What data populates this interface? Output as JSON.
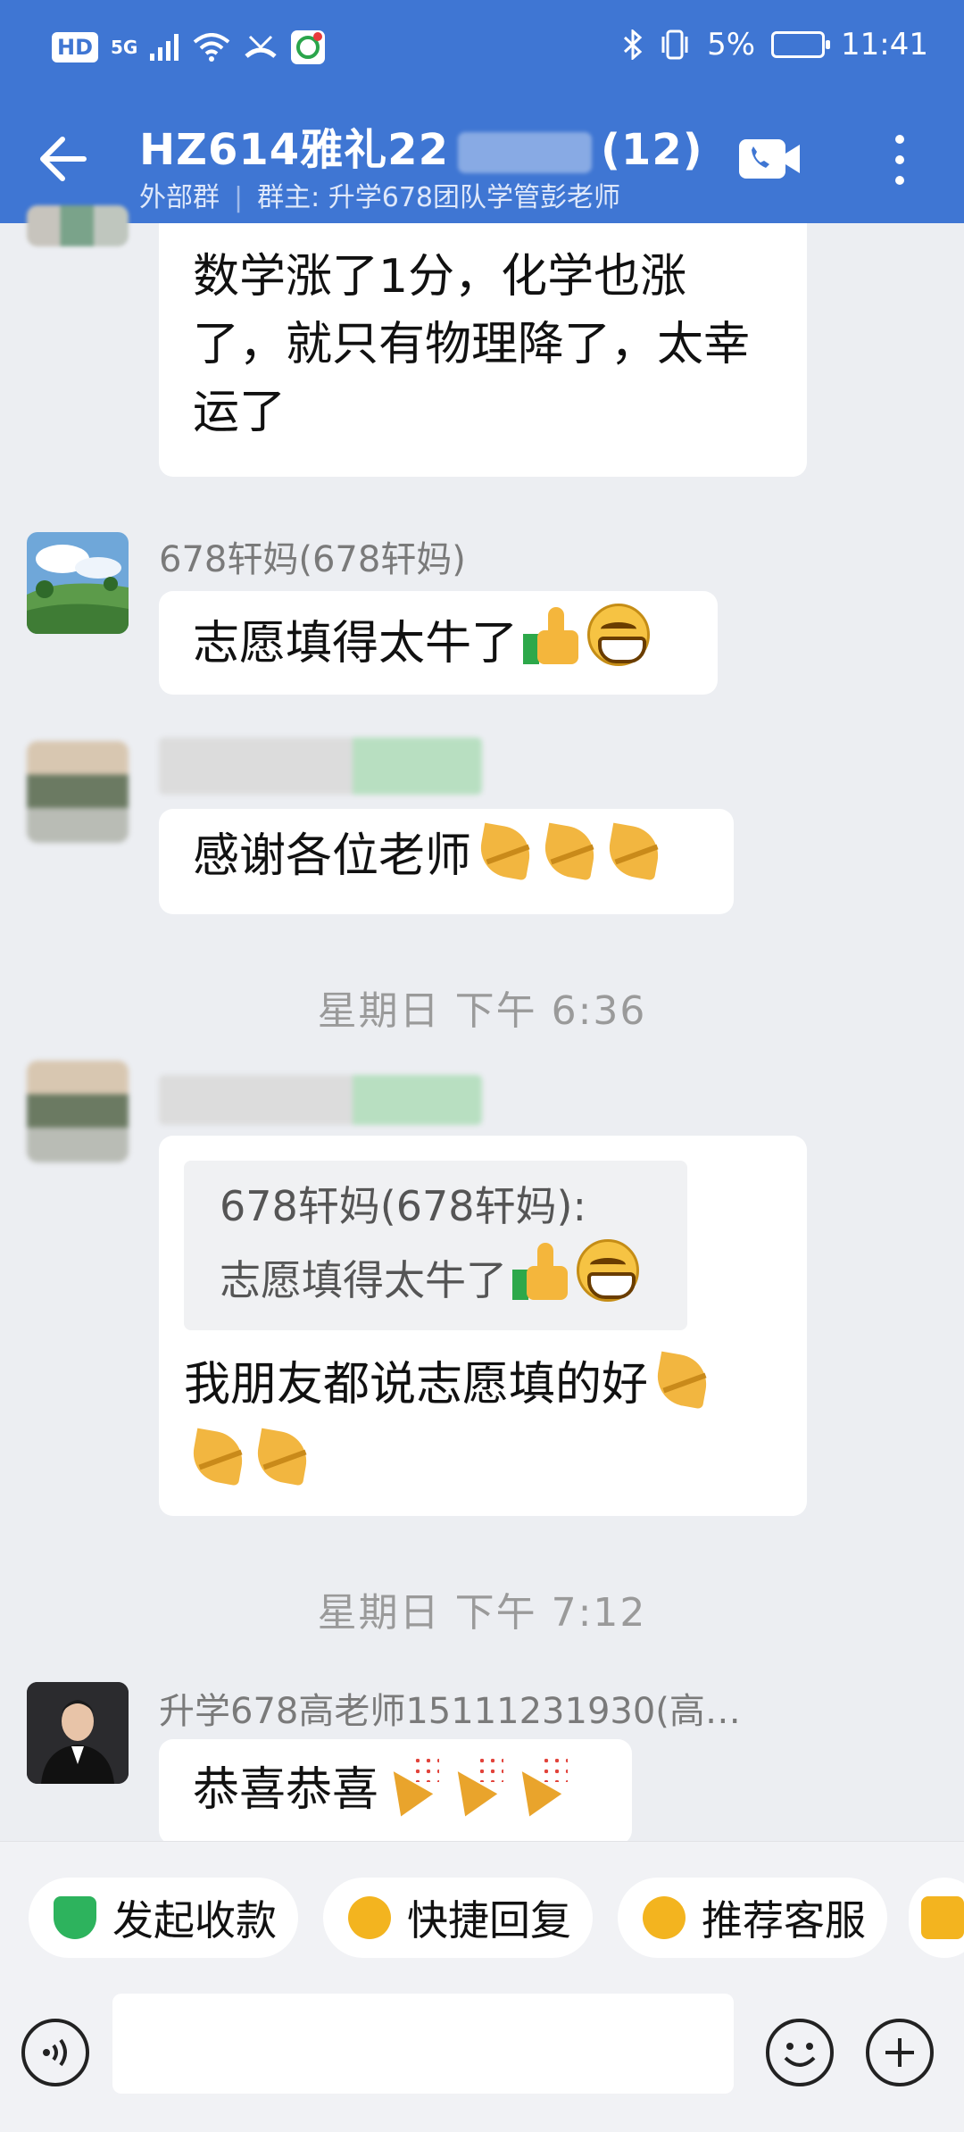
{
  "status_bar": {
    "left_badges": [
      "HD",
      "5G"
    ],
    "battery": "5%",
    "time": "11:41"
  },
  "header": {
    "title_prefix": "HZ614雅礼22",
    "title_count": "(12)",
    "subtitle_tag": "外部群",
    "subtitle_owner": "群主: 升学678团队学管彭老师",
    "bg_color": "#3f76d3"
  },
  "messages": [
    {
      "text": "数学涨了1分，化学也涨了，就只有物理降了，太幸运了"
    },
    {
      "sender": "678轩妈(678轩妈)",
      "text": "志愿填得太牛了"
    },
    {
      "text": "感谢各位老师"
    }
  ],
  "time_separators": [
    "星期日  下午 6:36",
    "星期日  下午 7:12"
  ],
  "quote": {
    "author": "678轩妈(678轩妈):",
    "text": "志愿填得太牛了",
    "reply": "我朋友都说志愿填的好"
  },
  "last_message": {
    "sender": "升学678高老师15111231930(高…",
    "text": "恭喜恭喜"
  },
  "quick_actions": [
    {
      "label": "发起收款",
      "color": "#2db35d"
    },
    {
      "label": "快捷回复",
      "color": "#f3b41f"
    },
    {
      "label": "推荐客服",
      "color": "#f3b41f"
    }
  ],
  "icons": [
    "back-arrow-icon",
    "video-call-icon",
    "more-icon",
    "voice-icon",
    "emoji-icon",
    "plus-icon"
  ]
}
